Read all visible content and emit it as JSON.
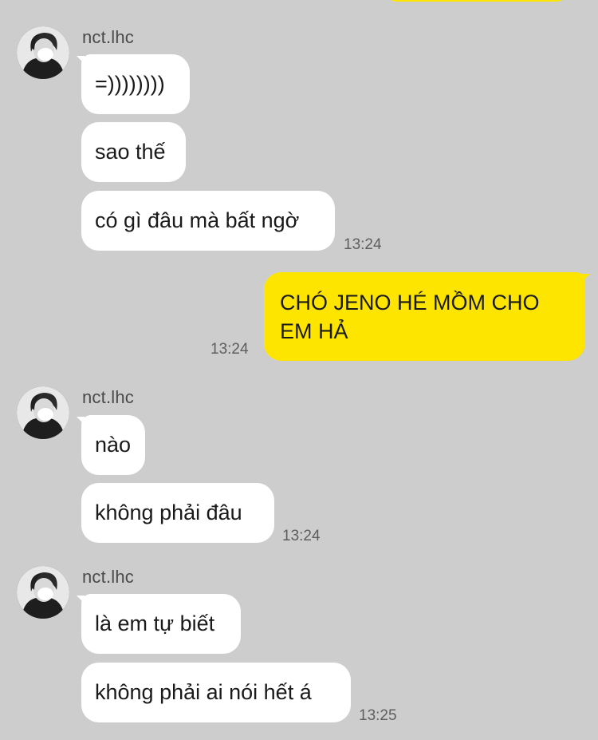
{
  "chat": {
    "groups": [
      {
        "sender": "nct.lhc",
        "messages": [
          "=))))))))",
          "sao thế",
          "có gì đâu mà bất ngờ"
        ],
        "time": "13:24"
      },
      {
        "sender": "me",
        "messages": [
          "CHÓ JENO HÉ MỒM CHO EM HẢ"
        ],
        "time": "13:24"
      },
      {
        "sender": "nct.lhc",
        "messages": [
          "nào",
          "không phải đâu"
        ],
        "time": "13:24"
      },
      {
        "sender": "nct.lhc",
        "messages": [
          "là em tự biết",
          "không phải ai nói hết á"
        ],
        "time": "13:25"
      }
    ]
  },
  "colors": {
    "background": "#cdcdcd",
    "incoming_bubble": "#ffffff",
    "outgoing_bubble": "#fee500",
    "timestamp": "#5e5e5e"
  },
  "icons": {
    "avatar": "profile-photo-masked-person"
  }
}
